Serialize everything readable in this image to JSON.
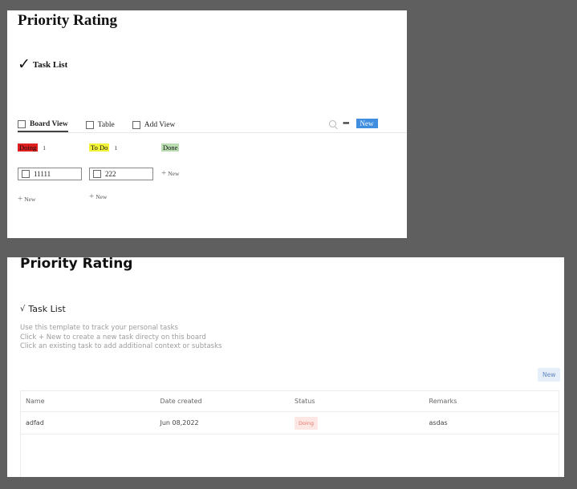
{
  "colors": {
    "doing": "#e01f1f",
    "todo": "#f2f23a",
    "done": "#b9ddb0",
    "accent": "#3f8ee0",
    "chip_bg": "#fde7e5",
    "chip_fg": "#e5786c"
  },
  "panel1": {
    "title": "Priority Rating",
    "task_list": {
      "icon": "checkmark-icon",
      "label": "Task List"
    },
    "views": [
      {
        "label": "Board View",
        "active": true
      },
      {
        "label": "Table",
        "active": false
      },
      {
        "label": "Add View",
        "active": false
      }
    ],
    "toolbar": {
      "search_icon": "search-icon",
      "more_icon": "more-icon",
      "new_label": "New"
    },
    "columns": [
      {
        "label": "Doing",
        "count": "1",
        "cards": [
          "11111"
        ],
        "add_label": "New"
      },
      {
        "label": "To Do",
        "count": "1",
        "cards": [
          "222"
        ],
        "add_label": "New"
      },
      {
        "label": "Done",
        "count": "",
        "cards": [],
        "add_label": "New"
      }
    ]
  },
  "panel2": {
    "title": "Priority Rating",
    "task_list": {
      "icon": "checkmark-icon",
      "label": "Task List"
    },
    "description": [
      "Use this template to track your personal tasks",
      "Click + New to create a new task directy on this board",
      "Click an existing task to add additional context or subtasks"
    ],
    "new_label": "New",
    "table": {
      "headers": [
        "Name",
        "Date created",
        "Status",
        "Remarks"
      ],
      "rows": [
        {
          "name": "adfad",
          "date": "Jun 08,2022",
          "status": "Doing",
          "remarks": "asdas"
        }
      ]
    }
  }
}
